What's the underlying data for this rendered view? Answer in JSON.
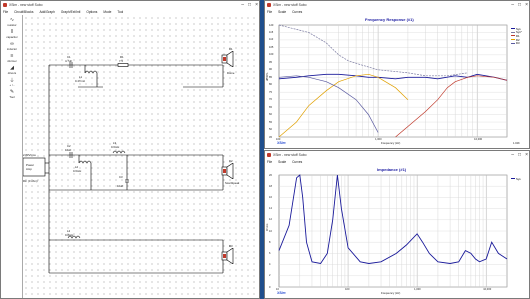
{
  "left_window": {
    "title": "XSim - new stuff Subo",
    "menu": [
      "File",
      "Circuit/Blocks",
      "Add/Graph",
      "Graph/Ext/Intl",
      "Options",
      "Mode",
      "Tool"
    ],
    "palette": [
      "resistor",
      "capacitor",
      "inductor",
      "xformer",
      "drivers",
      "+ / -",
      "Tool"
    ],
    "components": {
      "c1_name": "C1",
      "c1_value": "4.7uF",
      "l1_name": "L1",
      "l1_value": "0.47mH",
      "r1_name": "R1",
      "r1_value": "7.5",
      "d1_name": "D1",
      "d1_sub": "Dome",
      "c2_name": "C2",
      "c2_value": "10uF",
      "l2_name": "L2",
      "l2_value": "0.6mH",
      "c3_name": "C3",
      "c3_value": "10uF",
      "l3_name": "L3",
      "l3_value": "0.6mH",
      "d2_name": "D2",
      "d2_sub": "ScanSpeak",
      "l4_name": "L4",
      "l4_value": "0.8mH",
      "d3_name": "D3",
      "d3_sub": "",
      "source_label": "2.83V/rms",
      "amp_label1": "Power",
      "amp_label2": "Amp",
      "rs_label": "Rs: (0 ohm)"
    }
  },
  "fr_window": {
    "title": "XSim - new stuff Subo",
    "menu": [
      "File",
      "Scale",
      "Curves"
    ],
    "chart_title": "Frequency Response (#1)",
    "ylabel": "dBSPL",
    "xlabel": "Frequency (Hz)",
    "yticks": [
      "120",
      "115",
      "110",
      "105",
      "100",
      "95",
      "90",
      "85",
      "80",
      "75",
      "70",
      "65",
      "60",
      "55",
      "50",
      "45"
    ],
    "xticks": [
      "100",
      "1,000",
      "10,000"
    ],
    "brand": "XSim",
    "legend": [
      {
        "name": "Sys",
        "color": "#1a1a9a"
      },
      {
        "name": "Sys*",
        "color": "#7a7aa0"
      },
      {
        "name": "D1",
        "color": "#c0392b"
      },
      {
        "name": "D2",
        "color": "#e0a000"
      },
      {
        "name": "D3",
        "color": "#5a5aa0"
      }
    ],
    "corner_value": "1.02K"
  },
  "imp_window": {
    "title": "XSim - new stuff Subo",
    "menu": [
      "File",
      "Scale",
      "Curves"
    ],
    "chart_title": "Impedance (#1)",
    "ylabel": "Ohms",
    "xlabel": "Frequency (Hz)",
    "yticks": [
      "20",
      "18",
      "16",
      "14",
      "12",
      "10",
      "8",
      "6",
      "4",
      "2",
      "0"
    ],
    "xticks": [
      "10",
      "100",
      "1,000",
      "10,000"
    ],
    "brand": "XSim",
    "legend": [
      {
        "name": "Sys",
        "color": "#1a1a9a"
      }
    ]
  },
  "chart_data": [
    {
      "type": "line",
      "title": "Frequency Response (#1)",
      "xlabel": "Frequency (Hz)",
      "ylabel": "dBSPL",
      "xscale": "log",
      "xlim": [
        100,
        20000
      ],
      "ylim": [
        45,
        120
      ],
      "grid": true,
      "legend_position": "right",
      "series": [
        {
          "name": "Sys",
          "color": "#1a1a9a",
          "x": [
            100,
            150,
            200,
            300,
            400,
            600,
            800,
            1000,
            1500,
            2000,
            3000,
            4000,
            6000,
            8000,
            10000,
            15000,
            20000
          ],
          "y": [
            84,
            85,
            86,
            87,
            87,
            86,
            85,
            85,
            84,
            85,
            85,
            84,
            86,
            85,
            87,
            85,
            83
          ]
        },
        {
          "name": "D1",
          "color": "#c0392b",
          "x": [
            1500,
            2000,
            3000,
            4000,
            5000,
            6000,
            8000,
            10000,
            15000,
            20000
          ],
          "y": [
            45,
            52,
            62,
            70,
            78,
            82,
            85,
            86,
            85,
            83
          ]
        },
        {
          "name": "D2",
          "color": "#e0a000",
          "x": [
            100,
            150,
            200,
            300,
            400,
            600,
            800,
            1000,
            1500,
            2000
          ],
          "y": [
            45,
            55,
            66,
            76,
            82,
            86,
            87,
            85,
            78,
            70
          ]
        },
        {
          "name": "D3",
          "color": "#5a5aa0",
          "x": [
            100,
            150,
            200,
            300,
            400,
            600,
            800,
            1000
          ],
          "y": [
            85,
            86,
            85,
            82,
            78,
            70,
            60,
            48
          ]
        },
        {
          "name": "Sys*",
          "color": "#7a7aa0",
          "x": [
            100,
            200,
            300,
            400,
            500,
            700,
            1000,
            2000,
            3000,
            5000,
            8000
          ],
          "y": [
            120,
            115,
            108,
            100,
            96,
            93,
            90,
            88,
            86,
            86,
            88
          ]
        }
      ]
    },
    {
      "type": "line",
      "title": "Impedance (#1)",
      "xlabel": "Frequency (Hz)",
      "ylabel": "Ohms",
      "xscale": "log",
      "xlim": [
        10,
        20000
      ],
      "ylim": [
        0,
        20
      ],
      "grid": true,
      "legend_position": "right",
      "series": [
        {
          "name": "Sys",
          "color": "#1a1a9a",
          "x": [
            10,
            14,
            18,
            20,
            22,
            25,
            30,
            40,
            50,
            60,
            70,
            80,
            100,
            150,
            200,
            300,
            500,
            700,
            1000,
            1200,
            1500,
            2000,
            3000,
            4000,
            5000,
            6000,
            7000,
            8000,
            10000,
            12000,
            15000,
            20000
          ],
          "y": [
            6.5,
            11,
            19.5,
            20,
            16,
            8,
            4.5,
            4.2,
            6,
            12,
            20,
            14,
            7,
            4.5,
            4.2,
            4.5,
            6,
            7.5,
            9.5,
            8,
            6,
            4.5,
            4.2,
            4.5,
            6.5,
            6,
            5,
            4.5,
            5,
            8,
            6,
            5
          ]
        }
      ]
    }
  ]
}
